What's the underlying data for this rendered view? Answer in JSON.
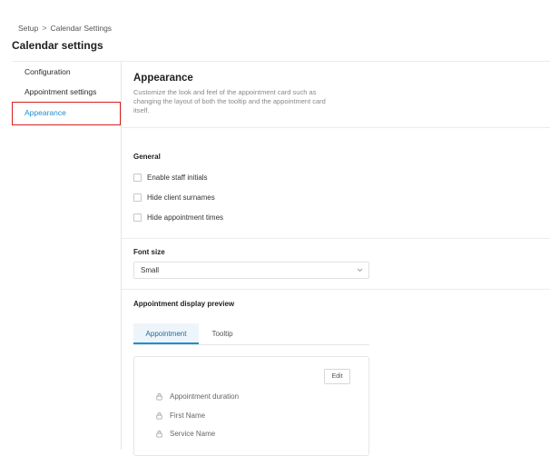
{
  "breadcrumb": {
    "root": "Setup",
    "separator": ">",
    "current": "Calendar Settings"
  },
  "page": {
    "title": "Calendar settings"
  },
  "sidebar": {
    "items": [
      {
        "label": "Configuration",
        "active": false
      },
      {
        "label": "Appointment settings",
        "active": false
      },
      {
        "label": "Appearance",
        "active": true
      }
    ]
  },
  "appearance": {
    "title": "Appearance",
    "description": "Customize the look and feel of the appointment card such as changing the layout of both the tooltip and the appointment card itself."
  },
  "general": {
    "label": "General",
    "options": [
      {
        "label": "Enable staff initials",
        "checked": false
      },
      {
        "label": "Hide client surnames",
        "checked": false
      },
      {
        "label": "Hide appointment times",
        "checked": false
      }
    ]
  },
  "font_size": {
    "label": "Font size",
    "value": "Small"
  },
  "preview": {
    "label": "Appointment display preview",
    "tabs": [
      {
        "label": "Appointment",
        "active": true
      },
      {
        "label": "Tooltip",
        "active": false
      }
    ],
    "edit_label": "Edit",
    "fields": [
      "Appointment duration",
      "First Name",
      "Service Name"
    ]
  },
  "colors": {
    "accent": "#1f8fcf",
    "highlight_border": "#d81e1e"
  }
}
